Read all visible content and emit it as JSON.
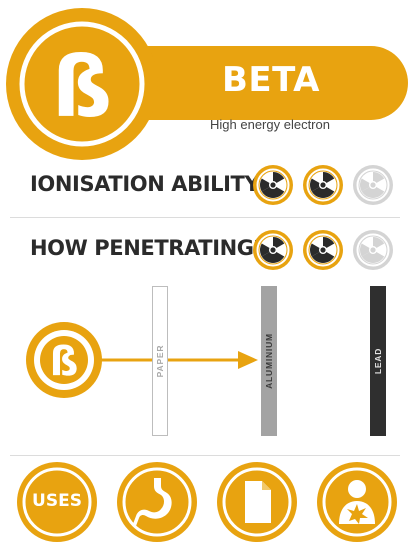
{
  "header": {
    "symbol": "ß",
    "title": "BETA",
    "subtitle": "High energy electron"
  },
  "ionisation": {
    "label": "IONISATION ABILITY:",
    "level": 2,
    "max": 3
  },
  "penetration": {
    "label": "HOW PENETRATING?",
    "level": 2,
    "max": 3,
    "symbol": "ß",
    "barriers": [
      {
        "name": "PAPER",
        "passes": true
      },
      {
        "name": "ALUMINIUM",
        "passes": false
      },
      {
        "name": "LEAD",
        "passes": false
      }
    ]
  },
  "uses": {
    "label": "USES",
    "icons": [
      "stomach-icon",
      "document-icon",
      "person-cancer-icon"
    ]
  },
  "colors": {
    "accent": "#e8a310",
    "inactive": "#d4d4d4",
    "text": "#2b2b2b",
    "paper": "#ffffff",
    "aluminium": "#a3a3a3",
    "lead": "#2f2f2f"
  }
}
